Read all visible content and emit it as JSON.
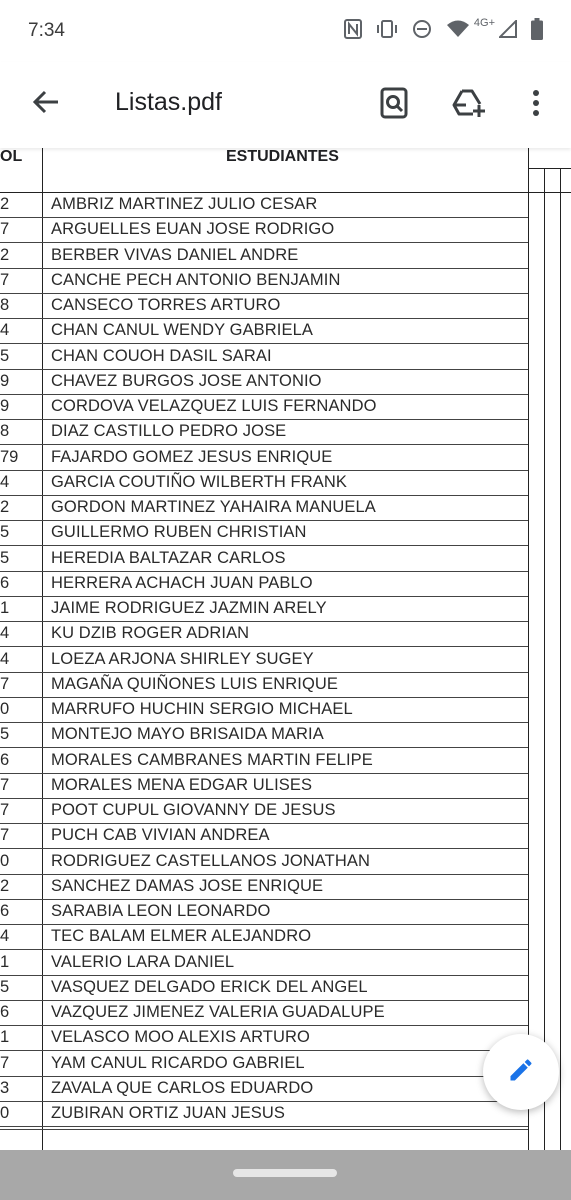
{
  "status_bar": {
    "time": "7:34",
    "network_label": "4G+",
    "icons": [
      "nfc-icon",
      "vibrate-icon",
      "do-not-disturb-icon",
      "wifi-icon",
      "signal-icon",
      "battery-icon"
    ]
  },
  "toolbar": {
    "title": "Listas.pdf",
    "back_icon": "arrow-back-icon",
    "search_icon": "search-in-document-icon",
    "drive_icon": "add-to-drive-icon",
    "more_icon": "more-vert-icon"
  },
  "document": {
    "header_left": "OL",
    "header_main": "ESTUDIANTES",
    "rows": [
      {
        "num": "2",
        "name": "AMBRIZ MARTINEZ JULIO CESAR"
      },
      {
        "num": "7",
        "name": "ARGUELLES EUAN JOSE RODRIGO"
      },
      {
        "num": "2",
        "name": "BERBER VIVAS DANIEL ANDRE"
      },
      {
        "num": "7",
        "name": "CANCHE PECH ANTONIO BENJAMIN"
      },
      {
        "num": "8",
        "name": "CANSECO TORRES ARTURO"
      },
      {
        "num": "4",
        "name": "CHAN CANUL WENDY GABRIELA"
      },
      {
        "num": "5",
        "name": "CHAN COUOH DASIL SARAI"
      },
      {
        "num": "9",
        "name": "CHAVEZ BURGOS JOSE ANTONIO"
      },
      {
        "num": "9",
        "name": "CORDOVA VELAZQUEZ LUIS FERNANDO"
      },
      {
        "num": "8",
        "name": "DIAZ CASTILLO PEDRO JOSE"
      },
      {
        "num": "79",
        "name": "FAJARDO GOMEZ JESUS ENRIQUE"
      },
      {
        "num": "4",
        "name": "GARCIA COUTIÑO WILBERTH FRANK"
      },
      {
        "num": "2",
        "name": "GORDON MARTINEZ YAHAIRA MANUELA"
      },
      {
        "num": "5",
        "name": "GUILLERMO  RUBEN CHRISTIAN"
      },
      {
        "num": "5",
        "name": "HEREDIA BALTAZAR CARLOS"
      },
      {
        "num": "6",
        "name": "HERRERA ACHACH JUAN PABLO"
      },
      {
        "num": "1",
        "name": "JAIME RODRIGUEZ JAZMIN ARELY"
      },
      {
        "num": "4",
        "name": "KU DZIB ROGER ADRIAN"
      },
      {
        "num": "4",
        "name": "LOEZA ARJONA SHIRLEY SUGEY"
      },
      {
        "num": "7",
        "name": "MAGAÑA QUIÑONES LUIS ENRIQUE"
      },
      {
        "num": "0",
        "name": "MARRUFO HUCHIN SERGIO MICHAEL"
      },
      {
        "num": "5",
        "name": "MONTEJO MAYO BRISAIDA MARIA"
      },
      {
        "num": "6",
        "name": "MORALES CAMBRANES MARTIN FELIPE"
      },
      {
        "num": "7",
        "name": "MORALES MENA EDGAR ULISES"
      },
      {
        "num": "7",
        "name": "POOT CUPUL GIOVANNY DE JESUS"
      },
      {
        "num": "7",
        "name": "PUCH CAB VIVIAN ANDREA"
      },
      {
        "num": "0",
        "name": "RODRIGUEZ CASTELLANOS JONATHAN"
      },
      {
        "num": "2",
        "name": "SANCHEZ DAMAS JOSE ENRIQUE"
      },
      {
        "num": "6",
        "name": "SARABIA LEON LEONARDO"
      },
      {
        "num": "4",
        "name": "TEC BALAM ELMER ALEJANDRO"
      },
      {
        "num": "1",
        "name": "VALERIO LARA DANIEL"
      },
      {
        "num": "5",
        "name": "VASQUEZ DELGADO ERICK DEL ANGEL"
      },
      {
        "num": "6",
        "name": "VAZQUEZ JIMENEZ VALERIA GUADALUPE"
      },
      {
        "num": "1",
        "name": "VELASCO MOO ALEXIS ARTURO"
      },
      {
        "num": "7",
        "name": "YAM CANUL RICARDO GABRIEL"
      },
      {
        "num": "3",
        "name": "ZAVALA QUE CARLOS EDUARDO"
      },
      {
        "num": "0",
        "name": "ZUBIRAN ORTIZ JUAN JESUS"
      }
    ]
  },
  "fab": {
    "icon": "edit-pencil-icon",
    "accent": "#1a73e8"
  }
}
